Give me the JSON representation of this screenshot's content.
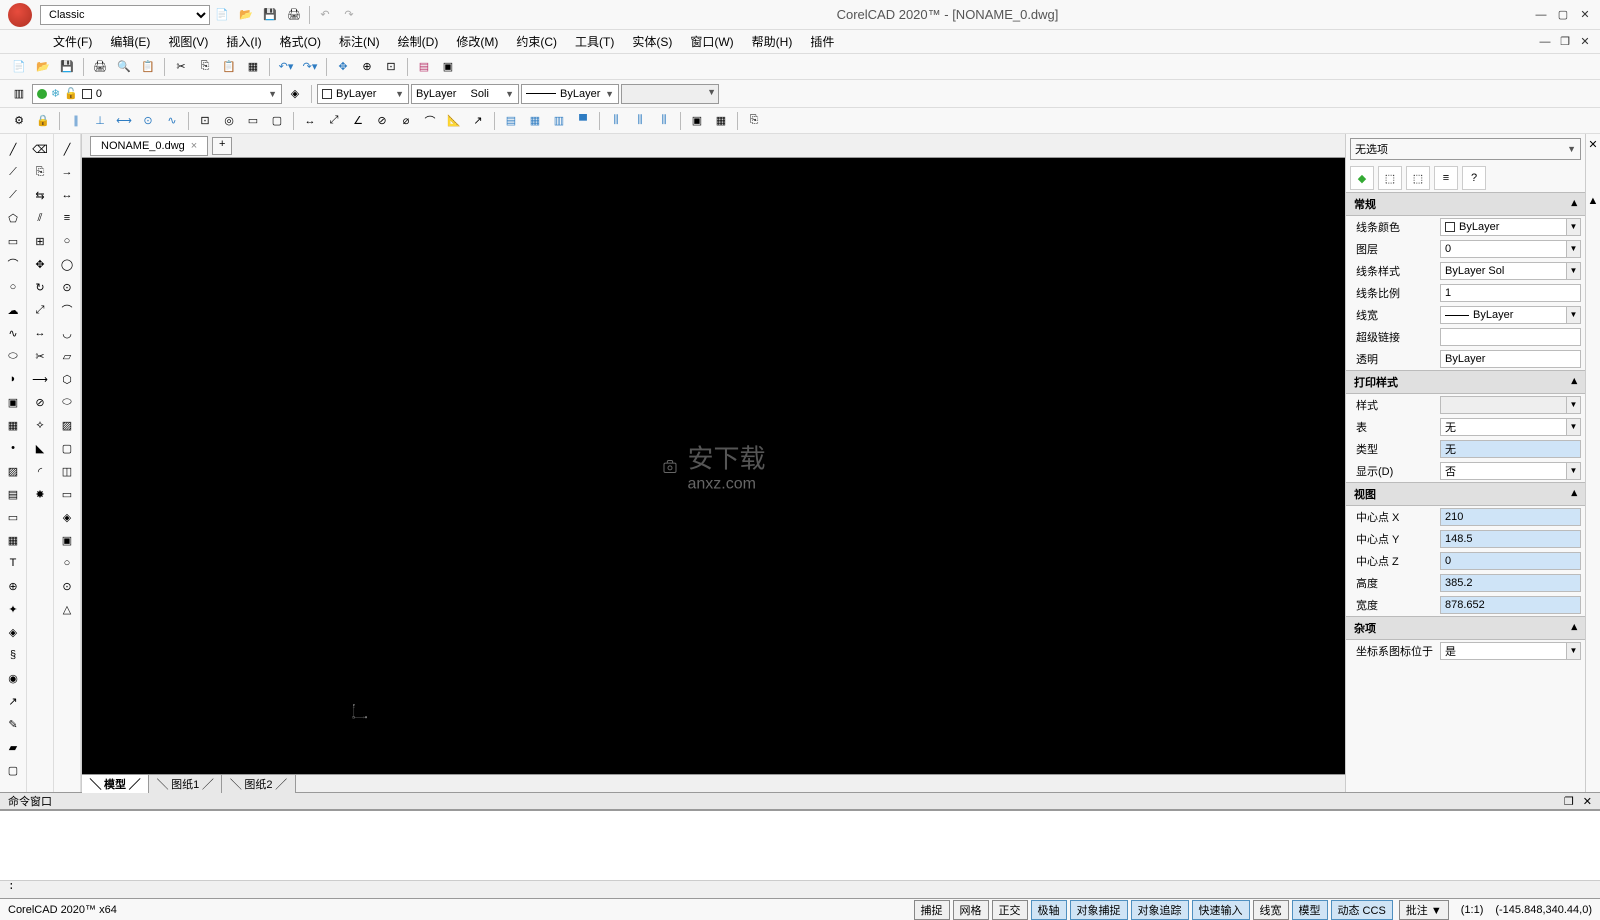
{
  "title": "CorelCAD 2020™ - [NONAME_0.dwg]",
  "workspace": "Classic",
  "menu": [
    "文件(F)",
    "编辑(E)",
    "视图(V)",
    "插入(I)",
    "格式(O)",
    "标注(N)",
    "绘制(D)",
    "修改(M)",
    "约束(C)",
    "工具(T)",
    "实体(S)",
    "窗口(W)",
    "帮助(H)",
    "插件"
  ],
  "layer_row": {
    "layer_name": "0",
    "color": "ByLayer",
    "linetype_left": "ByLayer",
    "linetype_right": "Soli",
    "lineweight": "ByLayer"
  },
  "doc_tab": "NONAME_0.dwg",
  "model_tabs": [
    "模型",
    "图纸1",
    "图纸2"
  ],
  "cmd_header": "命令窗口",
  "cmd_prompt": ":",
  "properties": {
    "selection": "无选项",
    "sections": {
      "general": {
        "title": "常规",
        "rows": [
          {
            "label": "线条颜色",
            "value": "ByLayer",
            "swatch": true,
            "dd": true
          },
          {
            "label": "图层",
            "value": "0",
            "dd": true
          },
          {
            "label": "线条样式",
            "value": "ByLayer        Sol",
            "dd": true
          },
          {
            "label": "线条比例",
            "value": "1"
          },
          {
            "label": "线宽",
            "value": "ByLayer",
            "line": true,
            "dd": true
          },
          {
            "label": "超级链接",
            "value": ""
          },
          {
            "label": "透明",
            "value": "ByLayer"
          }
        ]
      },
      "print": {
        "title": "打印样式",
        "rows": [
          {
            "label": "样式",
            "value": "",
            "gray": true,
            "dd": true
          },
          {
            "label": "表",
            "value": "无",
            "dd": true
          },
          {
            "label": "类型",
            "value": "无",
            "hl": true
          },
          {
            "label": "显示(D)",
            "value": "否",
            "dd": true
          }
        ]
      },
      "view": {
        "title": "视图",
        "rows": [
          {
            "label": "中心点 X",
            "value": "210",
            "hl": true
          },
          {
            "label": "中心点 Y",
            "value": "148.5",
            "hl": true
          },
          {
            "label": "中心点 Z",
            "value": "0",
            "hl": true
          },
          {
            "label": "高度",
            "value": "385.2",
            "hl": true
          },
          {
            "label": "宽度",
            "value": "878.652",
            "hl": true
          }
        ]
      },
      "misc": {
        "title": "杂项",
        "rows": [
          {
            "label": "坐标系图标位于",
            "value": "是",
            "dd": true
          }
        ]
      }
    }
  },
  "status": {
    "app": "CorelCAD 2020™ x64",
    "toggles": [
      {
        "t": "捕捉",
        "a": false
      },
      {
        "t": "网格",
        "a": false
      },
      {
        "t": "正交",
        "a": false
      },
      {
        "t": "极轴",
        "a": true
      },
      {
        "t": "对象捕捉",
        "a": true
      },
      {
        "t": "对象追踪",
        "a": true
      },
      {
        "t": "快速输入",
        "a": true
      },
      {
        "t": "线宽",
        "a": false
      },
      {
        "t": "模型",
        "a": true
      },
      {
        "t": "动态 CCS",
        "a": true
      }
    ],
    "annotation": "批注  ▼",
    "ratio": "(1:1)",
    "coords": "(-145.848,340.44,0)"
  },
  "watermark": {
    "text": "安下载",
    "url": "anxz.com"
  }
}
